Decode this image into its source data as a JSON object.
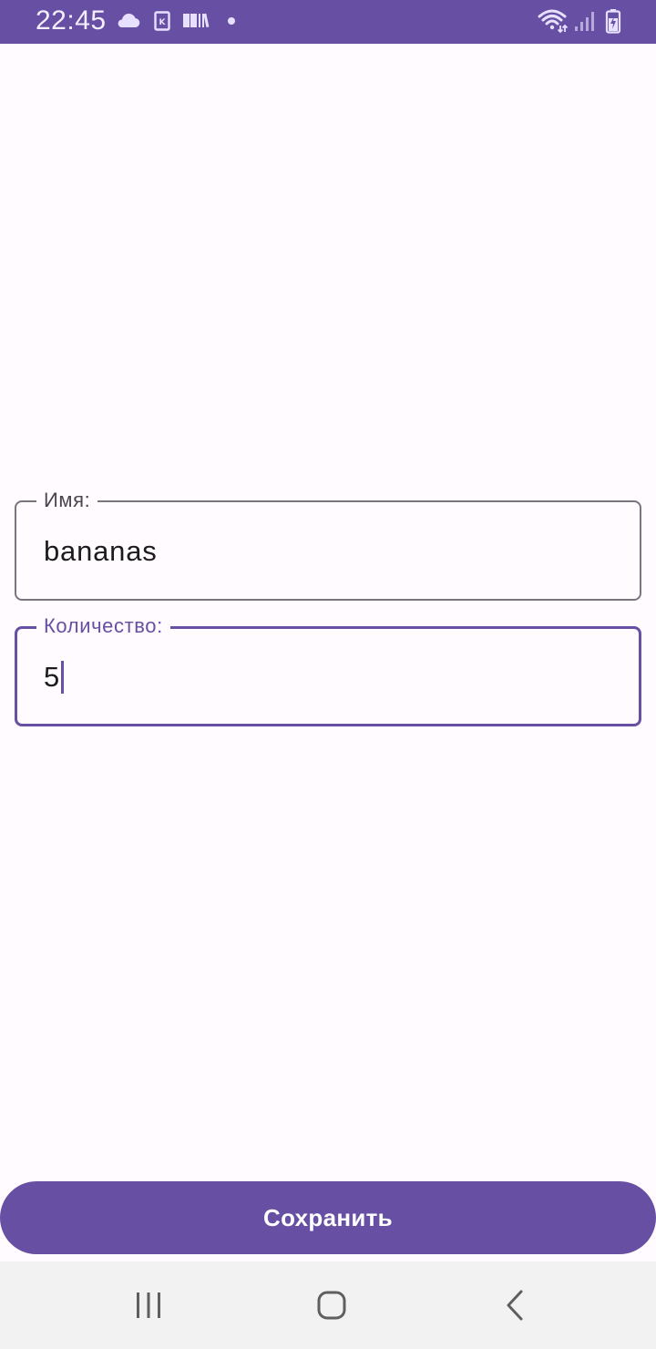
{
  "status_bar": {
    "time": "22:45",
    "icons": [
      "cloud-icon",
      "k-app-icon",
      "books-icon",
      "dot-icon",
      "wifi-icon",
      "signal-icon",
      "battery-charging-icon"
    ]
  },
  "form": {
    "name_field": {
      "label": "Имя:",
      "value": "bananas"
    },
    "quantity_field": {
      "label": "Количество:",
      "value": "5",
      "focused": true
    }
  },
  "save_button": {
    "label": "Сохранить"
  },
  "nav_bar": {
    "icons": [
      "recents-icon",
      "home-icon",
      "back-icon"
    ]
  },
  "colors": {
    "primary": "#6750a4",
    "background": "#fffbfe",
    "outline": "#79747e",
    "nav_background": "#f2f2f2"
  }
}
